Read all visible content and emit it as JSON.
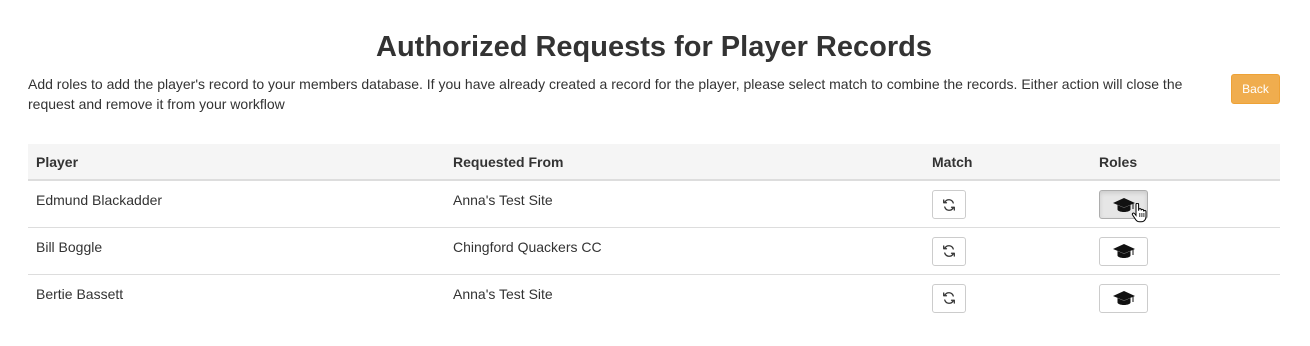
{
  "header": {
    "title": "Authorized Requests for Player Records",
    "description": "Add roles to add the player's record to your members database. If you have already created a record for the player, please select match to combine the records. Either action will close the request and remove it from your workflow",
    "back_label": "Back"
  },
  "colors": {
    "back_button": "#f0ad4e",
    "header_row": "#f5f5f5",
    "text": "#333333"
  },
  "table": {
    "columns": [
      "Player",
      "Requested From",
      "Match",
      "Roles"
    ],
    "rows": [
      {
        "player": "Edmund Blackadder",
        "requested_from": "Anna's Test Site",
        "match_icon": "refresh-icon",
        "roles_icon": "graduation-cap-icon",
        "roles_active": true
      },
      {
        "player": "Bill Boggle",
        "requested_from": "Chingford Quackers CC",
        "match_icon": "refresh-icon",
        "roles_icon": "graduation-cap-icon",
        "roles_active": false
      },
      {
        "player": "Bertie Bassett",
        "requested_from": "Anna's Test Site",
        "match_icon": "refresh-icon",
        "roles_icon": "graduation-cap-icon",
        "roles_active": false
      }
    ]
  }
}
